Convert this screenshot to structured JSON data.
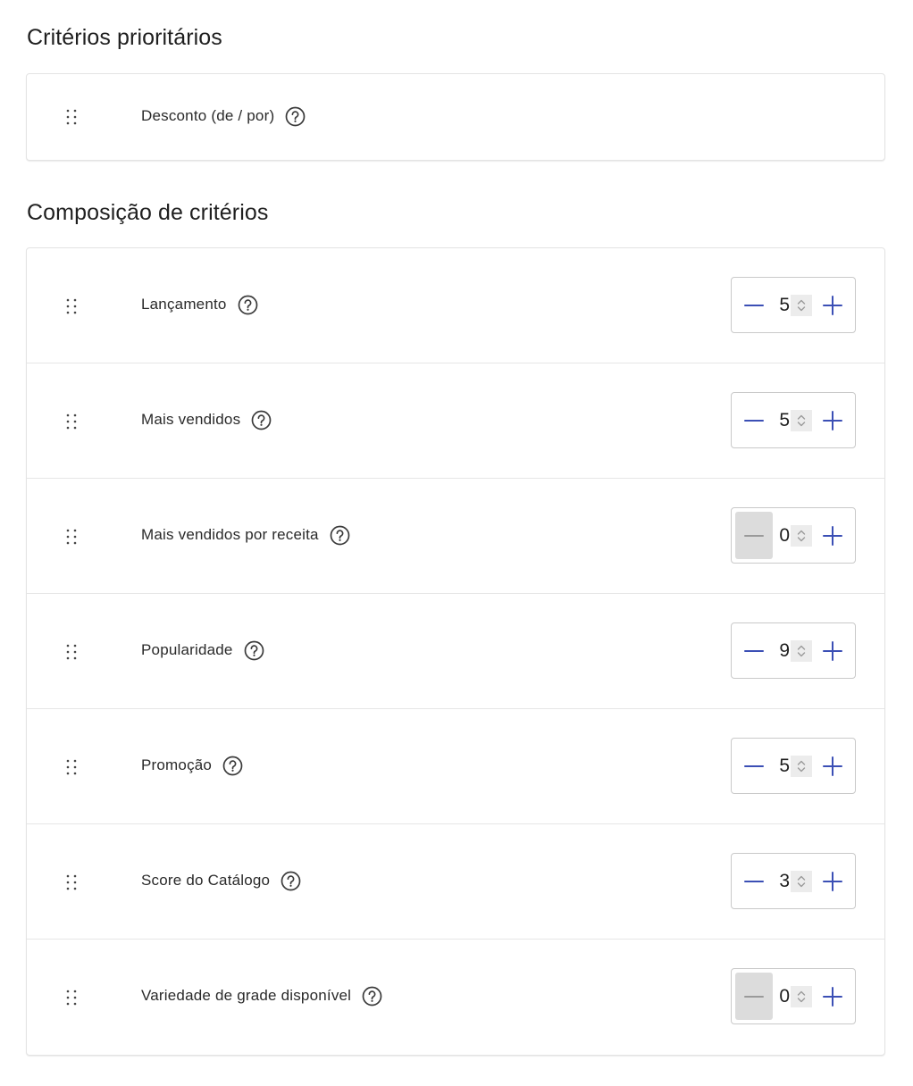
{
  "priority_section": {
    "title": "Critérios prioritários",
    "items": [
      {
        "label": "Desconto (de / por)"
      }
    ]
  },
  "composition_section": {
    "title": "Composição de critérios",
    "items": [
      {
        "label": "Lançamento",
        "value": "5",
        "minus_disabled": false
      },
      {
        "label": "Mais vendidos",
        "value": "5",
        "minus_disabled": false
      },
      {
        "label": "Mais vendidos por receita",
        "value": "0",
        "minus_disabled": true
      },
      {
        "label": "Popularidade",
        "value": "9",
        "minus_disabled": false
      },
      {
        "label": "Promoção",
        "value": "5",
        "minus_disabled": false
      },
      {
        "label": "Score do Catálogo",
        "value": "3",
        "minus_disabled": false
      },
      {
        "label": "Variedade de grade disponível",
        "value": "0",
        "minus_disabled": true
      }
    ]
  },
  "icons": {
    "drag": "drag-handle-icon",
    "help": "help-circle-icon",
    "minus": "minus-icon",
    "plus": "plus-icon",
    "spin": "chevron-up-down-icon"
  },
  "colors": {
    "accent": "#3b4fb5",
    "disabled_bg": "#dcdcdc",
    "disabled_fg": "#9a9a9a",
    "border": "#c9c9c9"
  }
}
